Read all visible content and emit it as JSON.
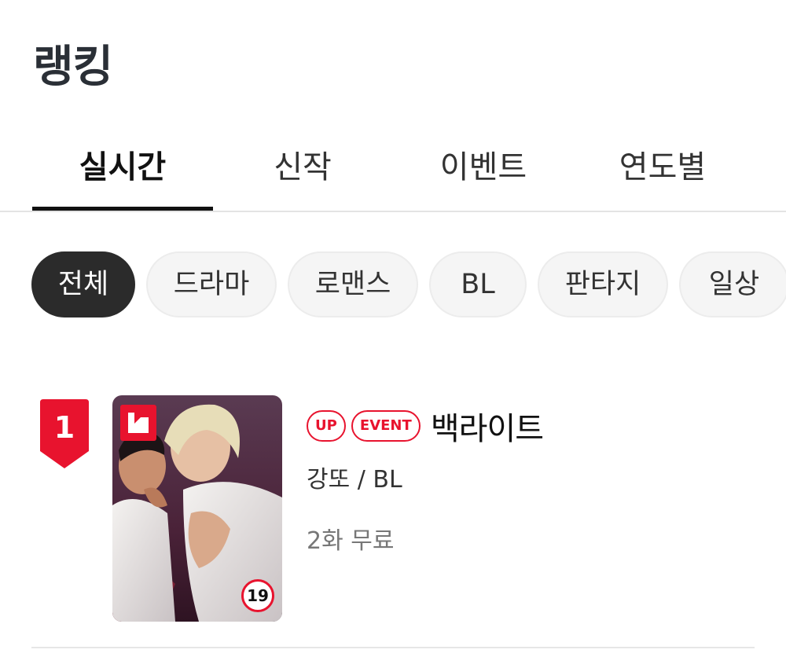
{
  "header": {
    "title": "랭킹"
  },
  "tabs": [
    {
      "label": "실시간",
      "active": true
    },
    {
      "label": "신작",
      "active": false
    },
    {
      "label": "이벤트",
      "active": false
    },
    {
      "label": "연도별",
      "active": false
    }
  ],
  "genres": [
    {
      "label": "전체",
      "active": true
    },
    {
      "label": "드라마",
      "active": false
    },
    {
      "label": "로맨스",
      "active": false
    },
    {
      "label": "BL",
      "active": false
    },
    {
      "label": "판타지",
      "active": false
    },
    {
      "label": "일상",
      "active": false
    }
  ],
  "ranking": [
    {
      "rank": "1",
      "tags": [
        "UP",
        "EVENT"
      ],
      "title": "백라이트",
      "author_genre": "강또 / BL",
      "free_info": "2화 무료",
      "age_rating": "19"
    }
  ],
  "colors": {
    "accent": "#e8132e",
    "active_chip": "#2b2b2b",
    "tab_underline": "#111111"
  }
}
